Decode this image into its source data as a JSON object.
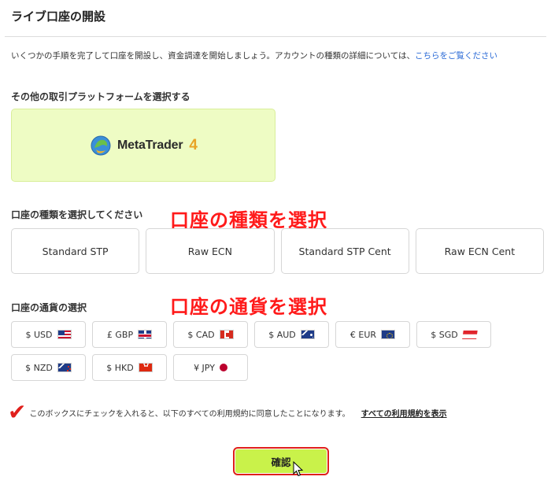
{
  "page": {
    "title": "ライブ口座の開設",
    "intro_text": "いくつかの手順を完了して口座を開設し、資金調達を開始しましょう。アカウントの種類の詳細については、",
    "intro_link": "こちらをご覧ください"
  },
  "platform": {
    "section_label": "その他の取引プラットフォームを選択する",
    "name": "MetaTrader",
    "version": "4",
    "icon": "metatrader-logo-icon"
  },
  "account_type": {
    "section_label": "口座の種類を選択してください",
    "annotation": "口座の種類を選択",
    "options": [
      "Standard STP",
      "Raw ECN",
      "Standard STP Cent",
      "Raw ECN Cent"
    ]
  },
  "currency": {
    "section_label": "口座の通貨の選択",
    "annotation": "口座の通貨を選択",
    "options": [
      {
        "label": "$ USD",
        "flag": "us-flag-icon"
      },
      {
        "label": "£ GBP",
        "flag": "uk-flag-icon"
      },
      {
        "label": "$ CAD",
        "flag": "canada-flag-icon"
      },
      {
        "label": "$ AUD",
        "flag": "australia-flag-icon"
      },
      {
        "label": "€ EUR",
        "flag": "eu-flag-icon"
      },
      {
        "label": "$ SGD",
        "flag": "singapore-flag-icon"
      },
      {
        "label": "$ NZD",
        "flag": "new-zealand-flag-icon"
      },
      {
        "label": "$ HKD",
        "flag": "hong-kong-flag-icon"
      },
      {
        "label": "¥ JPY",
        "flag": "japan-flag-icon"
      }
    ]
  },
  "agreement": {
    "checkmark": "✔",
    "text": "このボックスにチェックを入れると、以下のすべての利用規約に同意したことになります。",
    "link": "すべての利用規約を表示"
  },
  "confirm": {
    "label": "確認"
  },
  "colors": {
    "accent_green": "#c9f24a",
    "platform_bg": "#eefcc4",
    "annotation_red": "#ff1a1a"
  }
}
